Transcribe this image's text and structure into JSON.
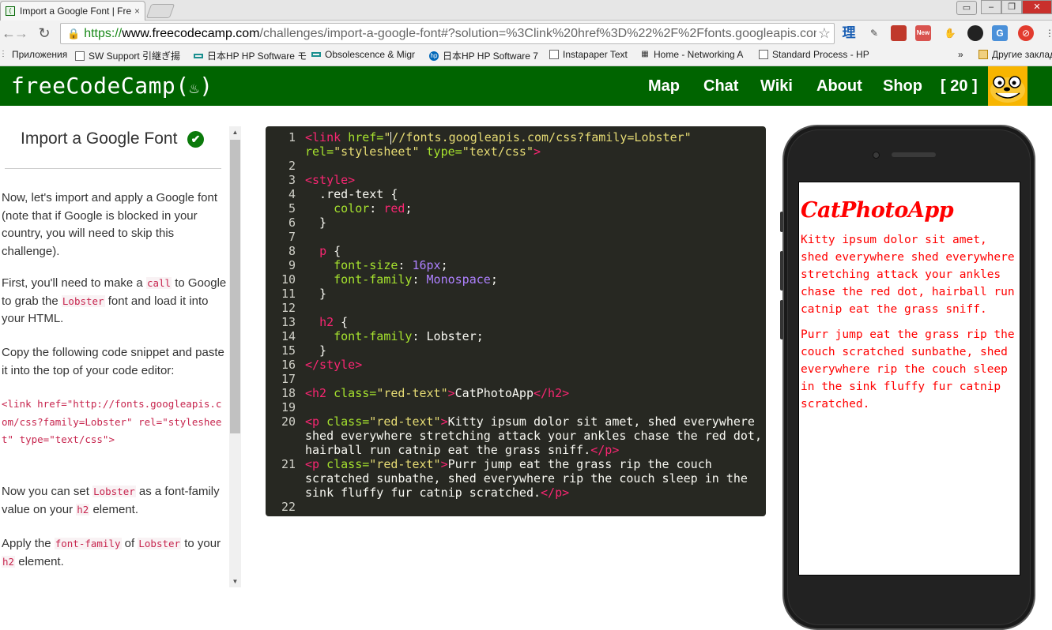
{
  "browser": {
    "tab_title": "Import a Google Font | Fre",
    "tab_close": "×",
    "url_scheme": "https://",
    "url_host": "www.freecodecamp.com",
    "url_path": "/challenges/import-a-google-font#?solution=%3Clink%20href%3D%22%2F%2Ffonts.googleapis.con",
    "star_glyph": "☆",
    "window_controls": {
      "min": "‒",
      "max": "❐",
      "close": "✕"
    },
    "extensions": [
      "理",
      "✎",
      "■",
      "New",
      "✋",
      "◕",
      "G",
      "⊘",
      "⋮"
    ]
  },
  "bookmarks": [
    {
      "icon": "apps-icon",
      "label": "Приложения"
    },
    {
      "icon": "page-icon",
      "label": "SW Support 引継ぎ揚"
    },
    {
      "icon": "dash-icon",
      "label": "日本HP HP Software モ"
    },
    {
      "icon": "dash-icon",
      "label": "Obsolescence & Migr"
    },
    {
      "icon": "hp-icon",
      "label": "日本HP HP Software 7"
    },
    {
      "icon": "page-icon",
      "label": "Instapaper Text"
    },
    {
      "icon": "grid-icon",
      "label": "Home - Networking A"
    },
    {
      "icon": "page-icon",
      "label": "Standard Process - HP"
    },
    {
      "icon": "more-icon",
      "label": "»"
    },
    {
      "icon": "folder-icon",
      "label": "Другие закладки"
    }
  ],
  "fcc": {
    "logo": "freeCodeCamp(",
    "logo_flame": "🔥",
    "logo_close": ")",
    "nav": [
      "Map",
      "Chat",
      "Wiki",
      "About",
      "Shop",
      "[ 20 ]"
    ],
    "colors": {
      "brand": "#006400",
      "avatar_bg": "#f7b500"
    }
  },
  "challenge": {
    "title": "Import a Google Font",
    "check": "✔",
    "p1": "Now, let's import and apply a Google font (note that if Google is blocked in your country, you will need to skip this challenge).",
    "p2_a": "First, you'll need to make a ",
    "p2_code1": "call",
    "p2_b": " to Google to grab the ",
    "p2_code2": "Lobster",
    "p2_c": " font and load it into your HTML.",
    "p3": "Copy the following code snippet and paste it into the top of your code editor:",
    "snippet": "<link href=\"http://fonts.googleapis.com/css?family=Lobster\" rel=\"stylesheet\" type=\"text/css\">",
    "p4_a": "Now you can set ",
    "p4_code1": "Lobster",
    "p4_b": " as a font-family value on your ",
    "p4_code2": "h2",
    "p4_c": " element.",
    "p5_a": "Apply the ",
    "p5_code1": "font-family",
    "p5_b": " of ",
    "p5_code2": "Lobster",
    "p5_c": " to your ",
    "p5_code3": "h2",
    "p5_d": " element."
  },
  "editor": {
    "lines": [
      {
        "n": "1",
        "segs": [
          [
            "t-tag",
            "<link "
          ],
          [
            "t-attr",
            "href="
          ],
          [
            "t-str",
            "\""
          ],
          [
            "cursor",
            ""
          ],
          [
            "t-str",
            "//fonts.googleapis.com/css?family=Lobster\""
          ]
        ]
      },
      {
        "n": "",
        "segs": [
          [
            "t-attr",
            "rel="
          ],
          [
            "t-str",
            "\"stylesheet\" "
          ],
          [
            "t-attr",
            "type="
          ],
          [
            "t-str",
            "\"text/css\""
          ],
          [
            "t-tag",
            ">"
          ]
        ]
      },
      {
        "n": "2",
        "segs": []
      },
      {
        "n": "3",
        "segs": [
          [
            "t-tag",
            "<style>"
          ]
        ]
      },
      {
        "n": "4",
        "segs": [
          [
            "t-plain",
            "  .red-text {"
          ]
        ]
      },
      {
        "n": "5",
        "segs": [
          [
            "t-plain",
            "    "
          ],
          [
            "t-prop",
            "color"
          ],
          [
            "t-plain",
            ": "
          ],
          [
            "t-red",
            "red"
          ],
          [
            "t-plain",
            ";"
          ]
        ]
      },
      {
        "n": "6",
        "segs": [
          [
            "t-plain",
            "  }"
          ]
        ]
      },
      {
        "n": "7",
        "segs": []
      },
      {
        "n": "8",
        "segs": [
          [
            "t-plain",
            "  "
          ],
          [
            "t-red",
            "p"
          ],
          [
            "t-plain",
            " {"
          ]
        ]
      },
      {
        "n": "9",
        "segs": [
          [
            "t-plain",
            "    "
          ],
          [
            "t-prop",
            "font-size"
          ],
          [
            "t-plain",
            ": "
          ],
          [
            "t-num",
            "16px"
          ],
          [
            "t-plain",
            ";"
          ]
        ]
      },
      {
        "n": "10",
        "segs": [
          [
            "t-plain",
            "    "
          ],
          [
            "t-prop",
            "font-family"
          ],
          [
            "t-plain",
            ": "
          ],
          [
            "t-kw",
            "Monospace"
          ],
          [
            "t-plain",
            ";"
          ]
        ]
      },
      {
        "n": "11",
        "segs": [
          [
            "t-plain",
            "  }"
          ]
        ]
      },
      {
        "n": "12",
        "segs": []
      },
      {
        "n": "13",
        "segs": [
          [
            "t-plain",
            "  "
          ],
          [
            "t-red",
            "h2"
          ],
          [
            "t-plain",
            " {"
          ]
        ]
      },
      {
        "n": "14",
        "segs": [
          [
            "t-plain",
            "    "
          ],
          [
            "t-prop",
            "font-family"
          ],
          [
            "t-plain",
            ": Lobster;"
          ]
        ]
      },
      {
        "n": "15",
        "segs": [
          [
            "t-plain",
            "  }"
          ]
        ]
      },
      {
        "n": "16",
        "segs": [
          [
            "t-tag",
            "</style>"
          ]
        ]
      },
      {
        "n": "17",
        "segs": []
      },
      {
        "n": "18",
        "segs": [
          [
            "t-tag",
            "<h2 "
          ],
          [
            "t-attr",
            "class="
          ],
          [
            "t-str",
            "\"red-text\""
          ],
          [
            "t-tag",
            ">"
          ],
          [
            "t-plain",
            "CatPhotoApp"
          ],
          [
            "t-tag",
            "</h2>"
          ]
        ]
      },
      {
        "n": "19",
        "segs": []
      },
      {
        "n": "20",
        "segs": [
          [
            "t-tag",
            "<p "
          ],
          [
            "t-attr",
            "class="
          ],
          [
            "t-str",
            "\"red-text\""
          ],
          [
            "t-tag",
            ">"
          ],
          [
            "t-plain",
            "Kitty ipsum dolor sit amet, shed everywhere"
          ]
        ]
      },
      {
        "n": "",
        "segs": [
          [
            "t-plain",
            "shed everywhere stretching attack your ankles chase the red dot,"
          ]
        ]
      },
      {
        "n": "",
        "segs": [
          [
            "t-plain",
            "hairball run catnip eat the grass sniff."
          ],
          [
            "t-tag",
            "</p>"
          ]
        ]
      },
      {
        "n": "21",
        "segs": [
          [
            "t-tag",
            "<p "
          ],
          [
            "t-attr",
            "class="
          ],
          [
            "t-str",
            "\"red-text\""
          ],
          [
            "t-tag",
            ">"
          ],
          [
            "t-plain",
            "Purr jump eat the grass rip the couch"
          ]
        ]
      },
      {
        "n": "",
        "segs": [
          [
            "t-plain",
            "scratched sunbathe, shed everywhere rip the couch sleep in the"
          ]
        ]
      },
      {
        "n": "",
        "segs": [
          [
            "t-plain",
            "sink fluffy fur catnip scratched."
          ],
          [
            "t-tag",
            "</p>"
          ]
        ]
      },
      {
        "n": "22",
        "segs": []
      }
    ]
  },
  "preview": {
    "h2": "CatPhotoApp",
    "p1": "Kitty ipsum dolor sit amet, shed everywhere shed everywhere stretching attack your ankles chase the red dot, hairball run catnip eat the grass sniff.",
    "p2": "Purr jump eat the grass rip the couch scratched sunbathe, shed everywhere rip the couch sleep in the sink fluffy fur catnip scratched.",
    "text_color": "#ff0000"
  }
}
